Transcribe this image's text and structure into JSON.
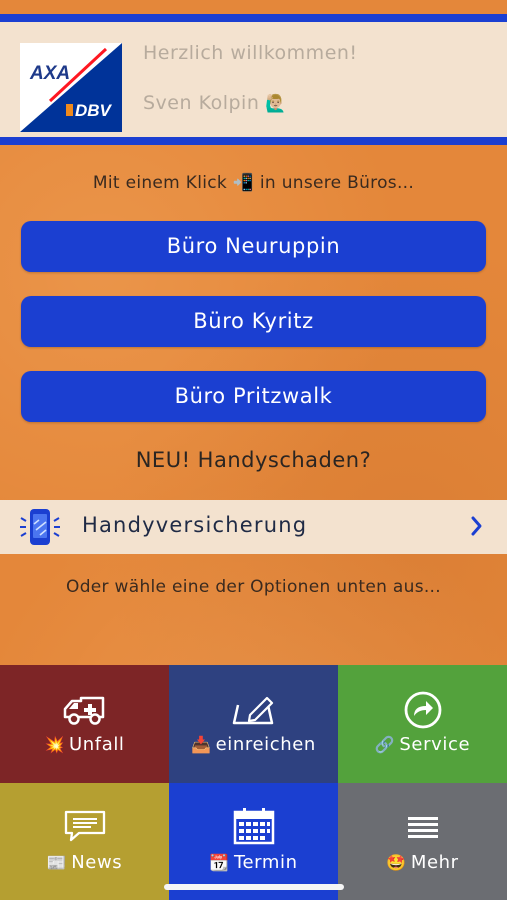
{
  "header": {
    "logo_text_top": "AXA",
    "logo_text_bottom": "DBV",
    "welcome": "Herzlich willkommen!",
    "user_name": "Sven Kolpin",
    "user_emoji": "🙋🏼‍♂️"
  },
  "main": {
    "tagline": "Mit einem Klick 📲 in unsere Büros...",
    "offices": [
      {
        "label": "Büro Neuruppin"
      },
      {
        "label": "Büro Kyritz"
      },
      {
        "label": "Büro Pritzwalk"
      }
    ],
    "new_title": "NEU! Handyschaden?",
    "insurance_label": "Handyversicherung",
    "options_text": "Oder wähle eine der Optionen unten aus..."
  },
  "tiles": [
    {
      "emoji": "💥",
      "label": "Unfall",
      "icon": "ambulance-icon",
      "color": "#7d2526"
    },
    {
      "emoji": "📥",
      "label": "einreichen",
      "icon": "pencil-box-icon",
      "color": "#2e4180"
    },
    {
      "emoji": "🔗",
      "label": "Service",
      "icon": "share-arrow-icon",
      "color": "#53a23c"
    },
    {
      "emoji": "📰",
      "label": "News",
      "icon": "message-icon",
      "color": "#b59f31"
    },
    {
      "emoji": "📆",
      "label": "Termin",
      "icon": "calendar-icon",
      "color": "#1b3fd1"
    },
    {
      "emoji": "🤩",
      "label": "Mehr",
      "icon": "menu-icon",
      "color": "#6b6d72"
    }
  ],
  "colors": {
    "background": "#e4873a",
    "accent_blue": "#1b3fd1",
    "header_bg": "#f3e2cf"
  }
}
